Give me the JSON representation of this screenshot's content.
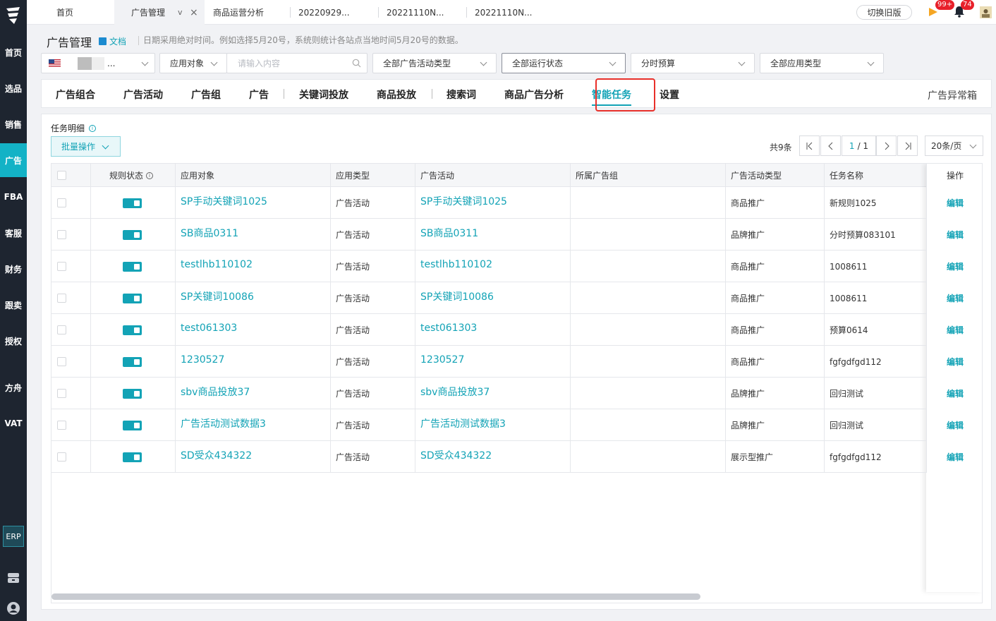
{
  "sidebar": {
    "items": [
      {
        "label": "首页"
      },
      {
        "label": "选品"
      },
      {
        "label": "销售"
      },
      {
        "label": "广告"
      },
      {
        "label": "FBA"
      },
      {
        "label": "客服"
      },
      {
        "label": "财务"
      },
      {
        "label": "跟卖"
      },
      {
        "label": "授权"
      },
      {
        "label": "方舟"
      },
      {
        "label": "VAT"
      }
    ],
    "erp_label": "ERP"
  },
  "tabs": [
    {
      "label": "首页"
    },
    {
      "label": "广告管理",
      "chevron": "v",
      "close": "×"
    },
    {
      "label": "商品运营分析"
    },
    {
      "label": "20220929..."
    },
    {
      "label": "20221110N..."
    },
    {
      "label": "20221110N..."
    }
  ],
  "topbar": {
    "old_version_label": "切换旧版",
    "notify_badge": "99+",
    "bell_badge": "74"
  },
  "page": {
    "title": "广告管理",
    "doc_label": "文档",
    "note": "日期采用绝对时间。例如选择5月20号，系统则统计各站点当地时间5月20号的数据。"
  },
  "filters": {
    "store_ellipsis": "...",
    "apply_target": "应用对象",
    "search_placeholder": "请输入内容",
    "campaign_type": "全部广告活动类型",
    "run_status": "全部运行状态",
    "budget": "分时预算",
    "apply_type": "全部应用类型"
  },
  "main_tabs": [
    {
      "label": "广告组合"
    },
    {
      "label": "广告活动"
    },
    {
      "label": "广告组"
    },
    {
      "label": "广告"
    },
    {
      "label": "关键词投放"
    },
    {
      "label": "商品投放"
    },
    {
      "label": "搜索词"
    },
    {
      "label": "商品广告分析"
    },
    {
      "label": "智能任务"
    },
    {
      "label": "设置"
    }
  ],
  "abnormal_box": "广告异常箱",
  "panel": {
    "title": "任务明细",
    "batch_label": "批量操作",
    "total": "共9条",
    "page_current": "1",
    "page_total": "/ 1",
    "page_size": "20条/页"
  },
  "table": {
    "headers": [
      "规则状态",
      "应用对象",
      "应用类型",
      "广告活动",
      "所属广告组",
      "广告活动类型",
      "任务名称",
      "操作"
    ],
    "rows": [
      {
        "target": "SP手动关键词1025",
        "type": "广告活动",
        "campaign": "SP手动关键词1025",
        "group": "",
        "ctype": "商品推广",
        "task": "新规则1025",
        "op": "编辑"
      },
      {
        "target": "SB商品0311",
        "type": "广告活动",
        "campaign": "SB商品0311",
        "group": "",
        "ctype": "品牌推广",
        "task": "分时预算083101",
        "op": "编辑"
      },
      {
        "target": "testlhb110102",
        "type": "广告活动",
        "campaign": "testlhb110102",
        "group": "",
        "ctype": "商品推广",
        "task": "1008611",
        "op": "编辑"
      },
      {
        "target": "SP关键词10086",
        "type": "广告活动",
        "campaign": "SP关键词10086",
        "group": "",
        "ctype": "商品推广",
        "task": "1008611",
        "op": "编辑"
      },
      {
        "target": "test061303",
        "type": "广告活动",
        "campaign": "test061303",
        "group": "",
        "ctype": "商品推广",
        "task": "预算0614",
        "op": "编辑"
      },
      {
        "target": "1230527",
        "type": "广告活动",
        "campaign": "1230527",
        "group": "",
        "ctype": "商品推广",
        "task": "fgfgdfgd112",
        "op": "编辑"
      },
      {
        "target": "sbv商品投放37",
        "type": "广告活动",
        "campaign": "sbv商品投放37",
        "group": "",
        "ctype": "品牌推广",
        "task": "回归测试",
        "op": "编辑"
      },
      {
        "target": "广告活动测试数据3",
        "type": "广告活动",
        "campaign": "广告活动测试数据3",
        "group": "",
        "ctype": "品牌推广",
        "task": "回归测试",
        "op": "编辑"
      },
      {
        "target": "SD受众434322",
        "type": "广告活动",
        "campaign": "SD受众434322",
        "group": "",
        "ctype": "展示型推广",
        "task": "fgfgdfgd112",
        "op": "编辑"
      }
    ]
  }
}
